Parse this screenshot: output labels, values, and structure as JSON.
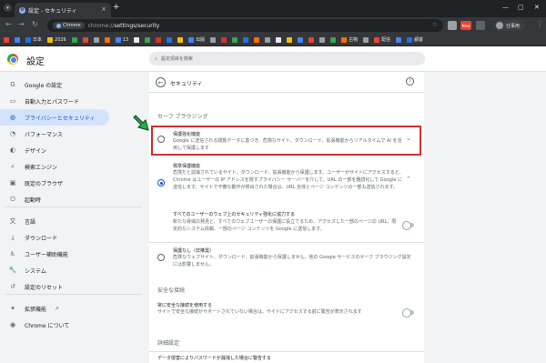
{
  "browser": {
    "tab_title": "設定 - セキュリティ",
    "url_chip": "Chrome",
    "url_host": "chrome://",
    "url_path": "settings/security",
    "profile_name": "仕事用",
    "ext_badge": "New"
  },
  "bookmarks": [
    {
      "label": "",
      "color": "#ea4335"
    },
    {
      "label": "",
      "color": "#4285f4"
    },
    {
      "label": "日本",
      "color": "#1a73e8"
    },
    {
      "label": "2026",
      "color": "#fbbc05"
    },
    {
      "label": "",
      "color": "#34a853"
    },
    {
      "label": "",
      "color": "#ea4335"
    },
    {
      "label": "",
      "color": "#9aa0a6"
    },
    {
      "label": "",
      "color": "#ff6d00"
    },
    {
      "label": "13",
      "color": "#4285f4"
    },
    {
      "label": "",
      "color": "#e8eaed"
    },
    {
      "label": "",
      "color": "#34a853"
    },
    {
      "label": "",
      "color": "#d93025"
    },
    {
      "label": "",
      "color": "#1877f2"
    },
    {
      "label": "",
      "color": "#fbbc05"
    },
    {
      "label": "出版",
      "color": "#4285f4"
    },
    {
      "label": "",
      "color": "#9aa0a6"
    },
    {
      "label": "",
      "color": "#d93025"
    },
    {
      "label": "",
      "color": "#34a853"
    },
    {
      "label": "",
      "color": "#1a73e8"
    },
    {
      "label": "",
      "color": "#ff6d00"
    },
    {
      "label": "",
      "color": "#9aa0a6"
    },
    {
      "label": "",
      "color": "#e8eaed"
    },
    {
      "label": "",
      "color": "#fbbc05"
    },
    {
      "label": "",
      "color": "#4285f4"
    },
    {
      "label": "",
      "color": "#ea4335"
    },
    {
      "label": "",
      "color": "#9aa0a6"
    },
    {
      "label": "",
      "color": "#34a853"
    },
    {
      "label": "古物",
      "color": "#ff6d00"
    },
    {
      "label": "",
      "color": "#9aa0a6"
    },
    {
      "label": "配信",
      "color": "#ea4335"
    },
    {
      "label": "",
      "color": "#4285f4"
    },
    {
      "label": "顧客",
      "color": "#1a73e8"
    }
  ],
  "settings": {
    "title": "設定",
    "search_placeholder": "設定項目を検索",
    "nav": [
      {
        "label": "Google の設定",
        "icon": "G"
      },
      {
        "label": "自動入力とパスワード",
        "icon": "▭"
      },
      {
        "label": "プライバシーとセキュリティ",
        "icon": "◍"
      },
      {
        "label": "パフォーマンス",
        "icon": "◔"
      },
      {
        "label": "デザイン",
        "icon": "◐"
      },
      {
        "label": "検索エンジン",
        "icon": "⌕"
      },
      {
        "label": "既定のブラウザ",
        "icon": "▣"
      },
      {
        "label": "起動時",
        "icon": "⏻"
      },
      {
        "label": "言語",
        "icon": "文"
      },
      {
        "label": "ダウンロード",
        "icon": "⤓"
      },
      {
        "label": "ユーザー補助機能",
        "icon": "♿"
      },
      {
        "label": "システム",
        "icon": "🔧"
      },
      {
        "label": "設定のリセット",
        "icon": "↺"
      },
      {
        "label": "拡張機能",
        "icon": "✦"
      },
      {
        "label": "Chrome について",
        "icon": "◉"
      }
    ],
    "page_title": "セキュリティ",
    "safe_browsing_label": "セーフ ブラウジング",
    "enhanced": {
      "title": "保護強化機能",
      "desc": "Google に送信される閲覧データに基づき、危険なサイト、ダウンロード、拡張機能からリアルタイムで AI を活用して保護します"
    },
    "standard": {
      "title": "標準保護機能",
      "desc": "危険だと認識されているサイト、ダウンロード、拡張機能から保護します。ユーザーがサイトにアクセスすると、Chrome はユーザーの IP アドレスを隠すプライバシー サーバーを介して、URL の一部を難読化して Google に送信します。サイトで不審な動作が検出された場合は、URL 全体とページ コンテンツの一部も送信されます。"
    },
    "help_improve": {
      "title": "すべてのユーザーのウェブ上のセキュリティ強化に協力する",
      "desc": "新たな脅威の発見と、すべてのウェブユーザーの保護に役立てるため、アクセスした一部のページの URL、限定的なシステム情報、一部のページ コンテンツを Google に送信します。"
    },
    "no_protection": {
      "title": "保護なし（非推奨）",
      "desc": "危険なウェブサイト、ダウンロード、拡張機能から保護しません。他の Google サービスのセーフ ブラウジング設定には影響しません。"
    },
    "secure_connections_label": "安全な接続",
    "https_first": {
      "title": "常に安全な接続を使用する",
      "desc": "サイトで安全な接続がサポートされていない場合は、サイトにアクセスする前に警告が表示されます"
    },
    "advanced_label": "詳細設定",
    "breach_warning": "データ侵害によりパスワードが漏洩した場合に警告する"
  }
}
